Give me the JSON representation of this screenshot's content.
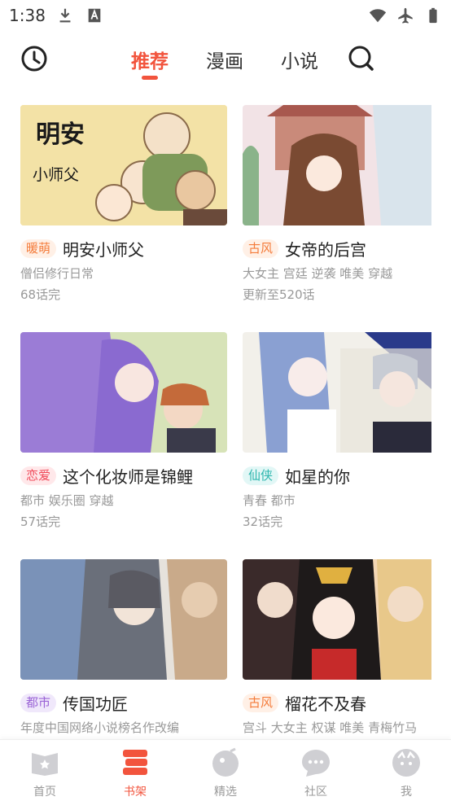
{
  "status_bar": {
    "time": "1:38",
    "icons_left": [
      "download-icon",
      "font-a-icon"
    ],
    "icons_right": [
      "wifi-icon",
      "airplane-icon",
      "battery-icon"
    ]
  },
  "top_nav": {
    "tabs": [
      {
        "label": "推荐",
        "active": true
      },
      {
        "label": "漫画",
        "active": false
      },
      {
        "label": "小说",
        "active": false
      }
    ],
    "left_icon": "history-icon",
    "right_icon": "search-icon",
    "accent_color": "#f2543d"
  },
  "books": [
    {
      "cover_text": "明安",
      "cover_subtext": "小师父",
      "tag": "暖萌",
      "tag_bg": "#fff0e6",
      "tag_color": "#f47b3a",
      "title": "明安小师父",
      "desc": "僧侣修行日常",
      "status": "68话完"
    },
    {
      "tag": "古风",
      "tag_bg": "#fff0e6",
      "tag_color": "#f47b3a",
      "title": "女帝的后宫",
      "desc": "大女主 宫廷 逆袭 唯美 穿越",
      "status": "更新至520话"
    },
    {
      "tag": "恋爱",
      "tag_bg": "#ffe8ea",
      "tag_color": "#f04a5a",
      "title": "这个化妆师是锦鲤",
      "desc": "都市 娱乐圈 穿越",
      "status": "57话完"
    },
    {
      "tag": "仙侠",
      "tag_bg": "#e2f7f6",
      "tag_color": "#2bb5ad",
      "title": "如星的你",
      "desc": "青春 都市",
      "status": "32话完"
    },
    {
      "tag": "都市",
      "tag_bg": "#f0e8fb",
      "tag_color": "#9a63d6",
      "title": "传国功匠",
      "desc": "年度中国网络小说榜名作改编",
      "status": ""
    },
    {
      "tag": "古风",
      "tag_bg": "#fff0e6",
      "tag_color": "#f47b3a",
      "title": "榴花不及春",
      "desc": "宫斗 大女主 权谋 唯美 青梅竹马",
      "status": ""
    }
  ],
  "bottom_nav": [
    {
      "label": "首页",
      "icon": "home-book-icon",
      "active": false
    },
    {
      "label": "书架",
      "icon": "bookshelf-icon",
      "active": true
    },
    {
      "label": "精选",
      "icon": "featured-icon",
      "active": false
    },
    {
      "label": "社区",
      "icon": "community-chat-icon",
      "active": false
    },
    {
      "label": "我",
      "icon": "profile-icon",
      "active": false
    }
  ]
}
